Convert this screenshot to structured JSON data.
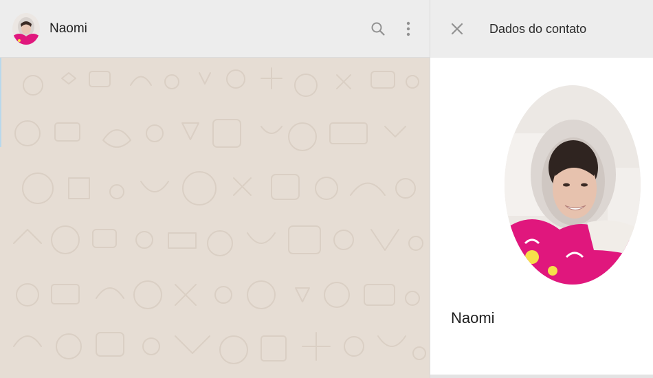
{
  "chat": {
    "contact_name": "Naomi",
    "actions": {
      "search_icon": "search-icon",
      "menu_icon": "more-vertical-icon"
    },
    "wallpaper_color": "#e6ddd4"
  },
  "contact_info": {
    "title": "Dados do contato",
    "close_icon": "close-icon",
    "name": "Naomi"
  },
  "colors": {
    "header_bg": "#ededed",
    "icon_gray": "#919191",
    "accent_pink": "#e0177d"
  }
}
